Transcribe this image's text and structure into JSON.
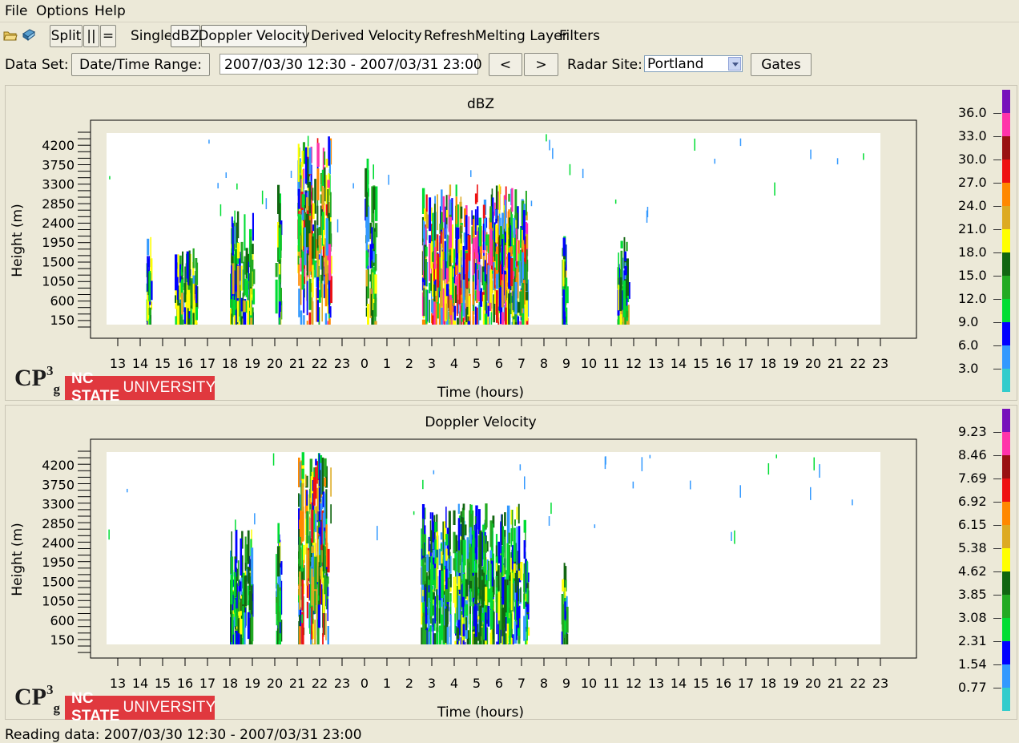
{
  "menu": [
    "File",
    "Options",
    "Help"
  ],
  "toolbar": {
    "split": "Split",
    "bars": "||",
    "equal": "=",
    "single": "Single",
    "dbz": "dBZ",
    "doppler": "Doppler Velocity",
    "derived": "Derived Velocity",
    "refresh": "Refresh",
    "melting": "Melting Layer",
    "filters": "Filters"
  },
  "dataset": {
    "label": "Data Set:",
    "date_range_button": "Date/Time Range:",
    "date_range_value": "2007/03/30 12:30 - 2007/03/31 23:00",
    "prev": "<",
    "next": ">",
    "radar_label": "Radar Site:",
    "radar_value": "Portland",
    "gates": "Gates"
  },
  "colors": {
    "scale": [
      "#33cccc",
      "#3399ff",
      "#0000ff",
      "#00dd33",
      "#22aa22",
      "#116611",
      "#ffff00",
      "#ddaa22",
      "#ff8800",
      "#ee1111",
      "#991111",
      "#ff33aa",
      "#7711bb"
    ]
  },
  "logo": {
    "cp": "CP",
    "cp_sup": "3",
    "cp_sub": "g",
    "nc_bold": "NC STATE",
    "nc_rest": "UNIVERSITY"
  },
  "status": "Reading data: 2007/03/30 12:30 - 2007/03/31 23:00",
  "chart_data": [
    {
      "type": "heatmap",
      "title": "dBZ",
      "xlabel": "Time (hours)",
      "ylabel": "Height (m)",
      "x_ticks": [
        "13",
        "14",
        "15",
        "16",
        "17",
        "18",
        "19",
        "20",
        "21",
        "22",
        "23",
        "0",
        "1",
        "2",
        "3",
        "4",
        "5",
        "6",
        "7",
        "8",
        "9",
        "10",
        "11",
        "12",
        "13",
        "14",
        "15",
        "16",
        "17",
        "18",
        "19",
        "20",
        "21",
        "22",
        "23"
      ],
      "y_ticks": [
        "150",
        "600",
        "1050",
        "1500",
        "1950",
        "2400",
        "2850",
        "3300",
        "3750",
        "4200"
      ],
      "colorbar_labels": [
        "3.0",
        "6.0",
        "9.0",
        "12.0",
        "15.0",
        "18.0",
        "21.0",
        "24.0",
        "27.0",
        "30.0",
        "33.0",
        "36.0"
      ],
      "value_bands": [
        {
          "x0": "20:00",
          "x1": "20:15",
          "h_max": 3300,
          "level": "12-15"
        },
        {
          "x0": "00:00",
          "x1": "00:30",
          "h_max": 4000,
          "level": "3-9"
        },
        {
          "x0": "02:30",
          "x1": "07:15",
          "h_max": 3300,
          "level": "9-21"
        },
        {
          "x0": "08:45",
          "x1": "09:00",
          "h_max": 2100,
          "level": "9-15"
        },
        {
          "x0": "11:15",
          "x1": "11:45",
          "h_max": 2100,
          "level": "6-12"
        },
        {
          "x0": "14:15",
          "x1": "14:30",
          "h_max": 2100,
          "level": "6-12"
        },
        {
          "x0": "15:30",
          "x1": "16:30",
          "h_max": 1800,
          "level": "6-12"
        },
        {
          "x0": "18:00",
          "x1": "19:00",
          "h_max": 2700,
          "level": "9-18"
        },
        {
          "x0": "21:00",
          "x1": "22:30",
          "h_max": 4500,
          "level": "12-30"
        }
      ]
    },
    {
      "type": "heatmap",
      "title": "Doppler Velocity",
      "xlabel": "Time (hours)",
      "ylabel": "Height (m)",
      "x_ticks": [
        "13",
        "14",
        "15",
        "16",
        "17",
        "18",
        "19",
        "20",
        "21",
        "22",
        "23",
        "0",
        "1",
        "2",
        "3",
        "4",
        "5",
        "6",
        "7",
        "8",
        "9",
        "10",
        "11",
        "12",
        "13",
        "14",
        "15",
        "16",
        "17",
        "18",
        "19",
        "20",
        "21",
        "22",
        "23"
      ],
      "y_ticks": [
        "150",
        "600",
        "1050",
        "1500",
        "1950",
        "2400",
        "2850",
        "3300",
        "3750",
        "4200"
      ],
      "colorbar_labels": [
        "0.77",
        "1.54",
        "2.31",
        "3.08",
        "3.85",
        "4.62",
        "5.38",
        "6.15",
        "6.92",
        "7.69",
        "8.46",
        "9.23"
      ],
      "value_bands": [
        {
          "x0": "20:00",
          "x1": "20:15",
          "h_max": 3300,
          "level": "0.77-1.54"
        },
        {
          "x0": "02:30",
          "x1": "07:15",
          "h_max": 3300,
          "level": "1.54-4.62"
        },
        {
          "x0": "08:45",
          "x1": "09:00",
          "h_max": 2100,
          "level": "1.54"
        },
        {
          "x0": "18:00",
          "x1": "19:00",
          "h_max": 2700,
          "level": "1.54-4.62"
        },
        {
          "x0": "21:00",
          "x1": "22:30",
          "h_max": 4500,
          "level": "0.77-6.15"
        }
      ]
    }
  ]
}
